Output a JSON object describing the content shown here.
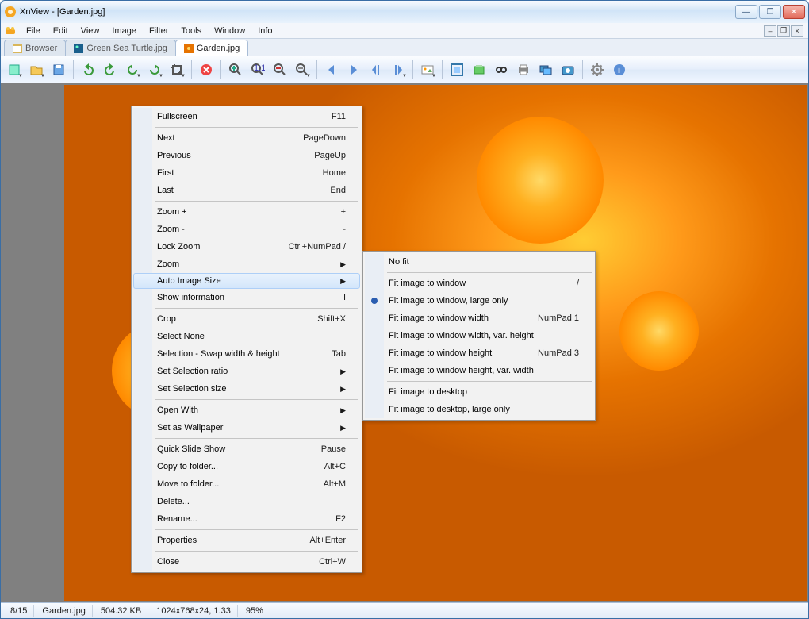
{
  "titlebar": {
    "app": "XnView",
    "doc": "[Garden.jpg]"
  },
  "menu": {
    "file": "File",
    "edit": "Edit",
    "view": "View",
    "image": "Image",
    "filter": "Filter",
    "tools": "Tools",
    "window": "Window",
    "info": "Info"
  },
  "tabs": {
    "browser": "Browser",
    "turtle": "Green Sea Turtle.jpg",
    "garden": "Garden.jpg"
  },
  "ctx_main": [
    {
      "label": "Fullscreen",
      "short": "F11"
    },
    "-",
    {
      "label": "Next",
      "short": "PageDown"
    },
    {
      "label": "Previous",
      "short": "PageUp"
    },
    {
      "label": "First",
      "short": "Home"
    },
    {
      "label": "Last",
      "short": "End"
    },
    "-",
    {
      "label": "Zoom +",
      "short": "+"
    },
    {
      "label": "Zoom -",
      "short": "-"
    },
    {
      "label": "Lock Zoom",
      "short": "Ctrl+NumPad /"
    },
    {
      "label": "Zoom",
      "submenu": true
    },
    {
      "label": "Auto Image Size",
      "submenu": true,
      "hover": true
    },
    {
      "label": "Show information",
      "short": "I"
    },
    "-",
    {
      "label": "Crop",
      "short": "Shift+X"
    },
    {
      "label": "Select None"
    },
    {
      "label": "Selection - Swap width & height",
      "short": "Tab"
    },
    {
      "label": "Set Selection ratio",
      "submenu": true
    },
    {
      "label": "Set Selection size",
      "submenu": true
    },
    "-",
    {
      "label": "Open With",
      "submenu": true
    },
    {
      "label": "Set as Wallpaper",
      "submenu": true
    },
    "-",
    {
      "label": "Quick Slide Show",
      "short": "Pause"
    },
    {
      "label": "Copy to folder...",
      "short": "Alt+C"
    },
    {
      "label": "Move to folder...",
      "short": "Alt+M"
    },
    {
      "label": "Delete..."
    },
    {
      "label": "Rename...",
      "short": "F2"
    },
    "-",
    {
      "label": "Properties",
      "short": "Alt+Enter"
    },
    "-",
    {
      "label": "Close",
      "short": "Ctrl+W"
    }
  ],
  "ctx_sub": [
    {
      "label": "No fit"
    },
    "-",
    {
      "label": "Fit image to window",
      "short": "/"
    },
    {
      "label": "Fit image to window, large only",
      "radio": true
    },
    {
      "label": "Fit image to window width",
      "short": "NumPad 1"
    },
    {
      "label": "Fit image to window width, var. height"
    },
    {
      "label": "Fit image to window height",
      "short": "NumPad 3"
    },
    {
      "label": "Fit image to window height, var. width"
    },
    "-",
    {
      "label": "Fit image to desktop"
    },
    {
      "label": "Fit image to desktop, large only"
    }
  ],
  "status": {
    "index": "8/15",
    "file": "Garden.jpg",
    "size": "504.32 KB",
    "dim": "1024x768x24, 1.33",
    "zoom": "95%"
  },
  "toolbar_icons": [
    "wizard",
    "open",
    "save",
    "sep",
    "undo",
    "redo",
    "rotate-ccw",
    "rotate-cw",
    "crop",
    "sep",
    "delete",
    "sep",
    "zoom-in",
    "zoom-1to1",
    "zoom-out",
    "zoom-fit",
    "sep",
    "prev",
    "next",
    "page-prev",
    "page-next",
    "sep",
    "slideshow",
    "sep",
    "fullscreen",
    "acquire",
    "find",
    "print",
    "batch",
    "camera",
    "sep",
    "settings",
    "about"
  ]
}
